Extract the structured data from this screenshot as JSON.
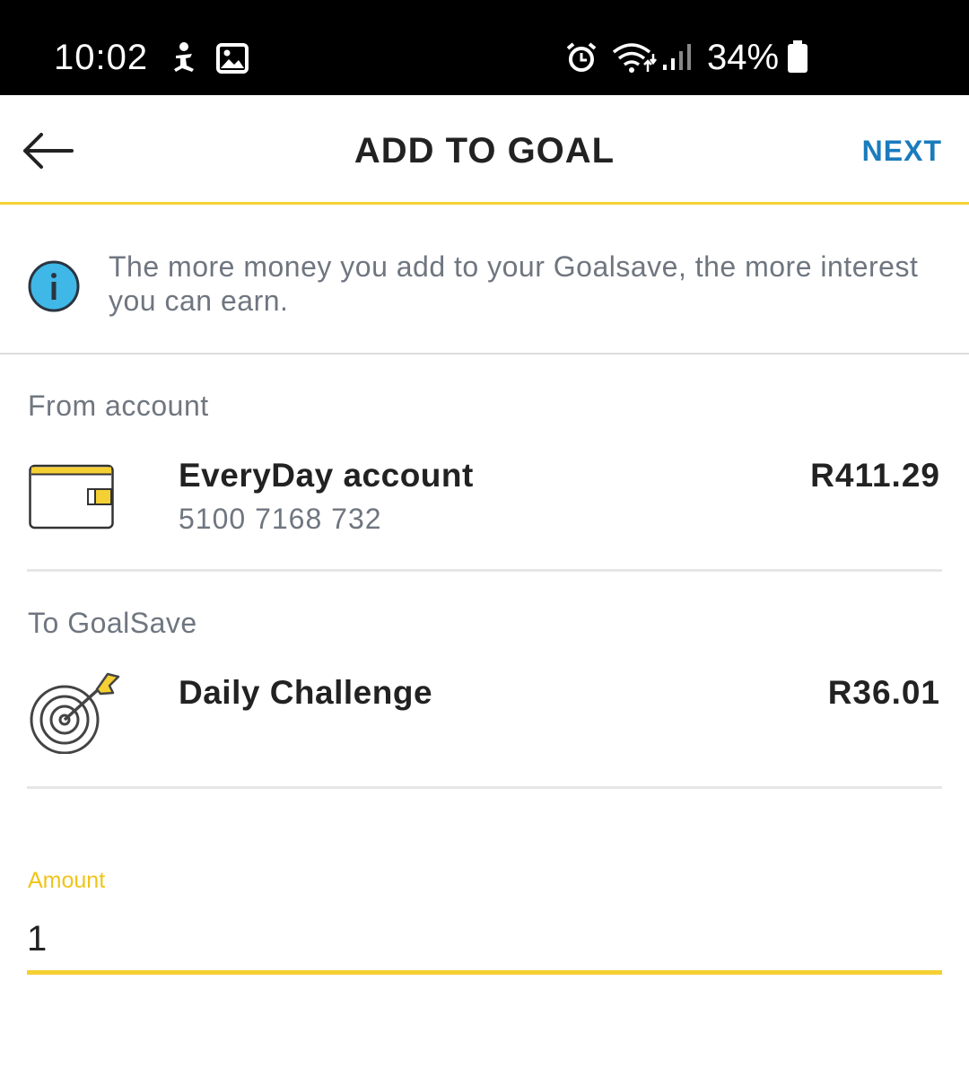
{
  "status_bar": {
    "time": "10:02",
    "battery": "34%",
    "icons": [
      "accessibility-icon",
      "gallery-icon",
      "alarm-icon",
      "wifi-icon",
      "signal-icon",
      "battery-icon"
    ]
  },
  "header": {
    "title": "ADD TO GOAL",
    "next_label": "NEXT",
    "back_icon": "back-arrow-icon"
  },
  "info": {
    "text": "The more money you add to your Goalsave, the more interest you can earn.",
    "icon": "info-icon"
  },
  "from_account": {
    "label": "From account",
    "name": "EveryDay account",
    "number": "5100 7168 732",
    "balance": "R411.29",
    "icon": "wallet-icon"
  },
  "to_goal": {
    "label": "To GoalSave",
    "name": "Daily Challenge",
    "balance": "R36.01",
    "icon": "target-icon"
  },
  "amount": {
    "label": "Amount",
    "value": "1"
  },
  "colors": {
    "accent_yellow": "#f5d034",
    "link_blue": "#1a7bbd",
    "info_blue": "#3fb8e8"
  }
}
